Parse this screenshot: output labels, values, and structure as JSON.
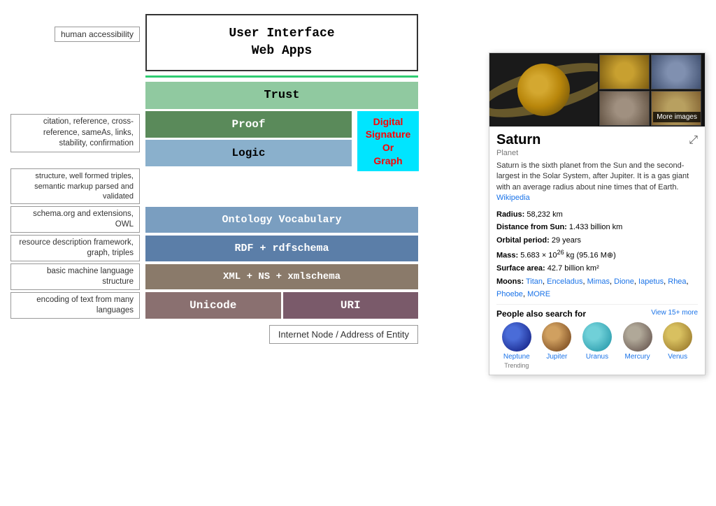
{
  "diagram": {
    "title": "User Interface\nWeb Apps",
    "human_label": "human accessibility",
    "green_line": true,
    "layers": [
      {
        "id": "trust",
        "label": "Trust",
        "color": "#90c9a0",
        "text_color": "#000"
      },
      {
        "id": "proof",
        "label": "Proof",
        "color": "#5a8a5a",
        "text_color": "#fff"
      },
      {
        "id": "logic",
        "label": "Logic",
        "color": "#8ab0cc",
        "text_color": "#000"
      },
      {
        "id": "ontology",
        "label": "Ontology Vocabulary",
        "color": "#7a9ec0",
        "text_color": "#fff"
      },
      {
        "id": "rdf",
        "label": "RDF + rdfschema",
        "color": "#5b7ea8",
        "text_color": "#fff"
      },
      {
        "id": "xml",
        "label": "XML + NS + xmlschema",
        "color": "#8a7a6a",
        "text_color": "#fff"
      },
      {
        "id": "unicode",
        "label": "Unicode",
        "color": "#8a7070",
        "text_color": "#fff"
      },
      {
        "id": "uri",
        "label": "URI",
        "color": "#7a5a6a",
        "text_color": "#fff"
      }
    ],
    "digital_signature": "Digital\nSignature\nOr\nGraph",
    "labels": {
      "citation": "citation, reference, cross-\nreference, sameAs, links,\nstability, confirmation",
      "structure": "structure, well formed triples, semantic\nmarkup parsed and validated",
      "schemaorg": "schema.org and\nextensions, OWL",
      "resource": "resource description\nframework, graph, triples",
      "basic_machine": "basic machine language structure",
      "encoding": "encoding of text from many languages"
    },
    "internet_node": "Internet Node / Address of Entity"
  },
  "saturn_panel": {
    "title": "Saturn",
    "subtitle": "Planet",
    "description": "Saturn is the sixth planet from the Sun and the second-largest in the Solar System, after Jupiter. It is a gas giant with an average radius about nine times that of Earth.",
    "wiki_link": "Wikipedia",
    "stats": [
      {
        "label": "Radius:",
        "value": "58,232 km"
      },
      {
        "label": "Distance from Sun:",
        "value": "1.433 billion km"
      },
      {
        "label": "Orbital period:",
        "value": "29 years"
      },
      {
        "label": "Mass:",
        "value": "5.683 × 10^26 kg (95.16 M⊕)"
      },
      {
        "label": "Surface area:",
        "value": "42.7 billion km²"
      },
      {
        "label": "Moons:",
        "value": "Titan, Enceladus, Mimas, Dione, Iapetus, Rhea, Phoebe, MORE"
      }
    ],
    "people_search_title": "People also search for",
    "view_more": "View 15+ more",
    "planets": [
      {
        "name": "Neptune",
        "trending": "Trending"
      },
      {
        "name": "Jupiter",
        "trending": ""
      },
      {
        "name": "Uranus",
        "trending": ""
      },
      {
        "name": "Mercury",
        "trending": ""
      },
      {
        "name": "Venus",
        "trending": ""
      }
    ],
    "more_images": "More images"
  }
}
